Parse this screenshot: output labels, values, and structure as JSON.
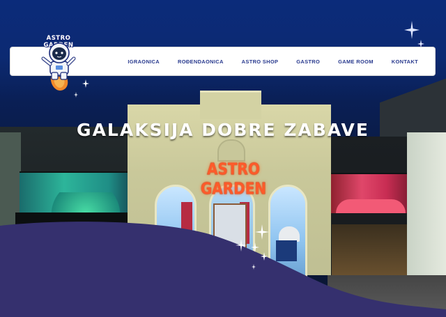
{
  "logo": {
    "text": "ASTRO GARDEN"
  },
  "nav": {
    "items": [
      {
        "label": "IGRAONICA"
      },
      {
        "label": "ROĐENDAONICA"
      },
      {
        "label": "ASTRO SHOP"
      },
      {
        "label": "GASTRO"
      },
      {
        "label": "GAME ROOM"
      },
      {
        "label": "KONTAKT"
      }
    ]
  },
  "hero": {
    "headline": "GALAKSIJA DOBRE ZABAVE",
    "sign": "ASTRO GARDEN"
  },
  "colors": {
    "sky_top": "#0b2b7a",
    "nav_text": "#2a3b8f",
    "wave": "#35306e",
    "sign": "#ff5a2a"
  },
  "icons": [
    "astronaut-logo-icon",
    "sparkle-star-icon",
    "moon-icon"
  ]
}
